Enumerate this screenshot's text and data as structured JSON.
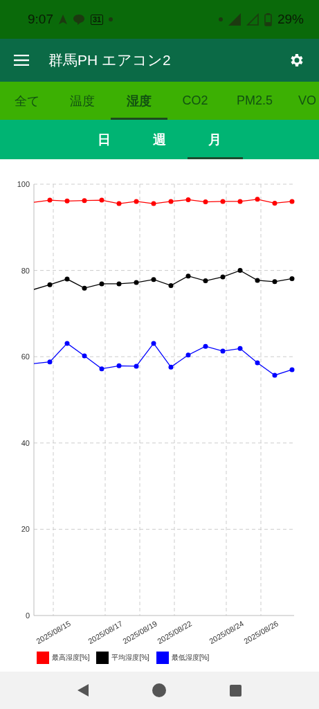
{
  "status_bar": {
    "time": "9:07",
    "calendar_date": "31",
    "battery": "29%"
  },
  "toolbar": {
    "title": "群馬PH エアコン2"
  },
  "tabs": [
    {
      "label": "全て",
      "selected": false
    },
    {
      "label": "温度",
      "selected": false
    },
    {
      "label": "湿度",
      "selected": true
    },
    {
      "label": "CO2",
      "selected": false
    },
    {
      "label": "PM2.5",
      "selected": false
    },
    {
      "label": "VO",
      "selected": false
    }
  ],
  "period_tabs": [
    {
      "label": "日",
      "selected": false
    },
    {
      "label": "週",
      "selected": false
    },
    {
      "label": "月",
      "selected": true
    }
  ],
  "chart": {
    "chart_data": {
      "type": "line",
      "categories": [
        null,
        "2025/08/15",
        null,
        null,
        "2025/08/17",
        null,
        "2025/08/19",
        null,
        "2025/08/22",
        null,
        null,
        "2025/08/24",
        null,
        "2025/08/26",
        null,
        null
      ],
      "ylim": [
        0,
        100
      ],
      "yticks": [
        0,
        20,
        40,
        60,
        80,
        100
      ],
      "grid": true,
      "series": [
        {
          "name": "最高湿度[%]",
          "color": "#ff0000",
          "marker": "circle",
          "values": [
            95.8,
            96.3,
            96.1,
            96.2,
            96.3,
            95.5,
            96.0,
            95.5,
            96.0,
            96.4,
            95.9,
            96.0,
            96.0,
            96.5,
            95.6,
            96.0
          ]
        },
        {
          "name": "平均湿度[%]",
          "color": "#000000",
          "marker": "circle",
          "values": [
            75.6,
            76.7,
            78.0,
            75.9,
            76.9,
            76.9,
            77.2,
            77.9,
            76.5,
            78.7,
            77.6,
            78.5,
            80.0,
            77.7,
            77.4,
            78.1
          ]
        },
        {
          "name": "最低湿度[%]",
          "color": "#0000ff",
          "marker": "circle",
          "values": [
            58.4,
            58.8,
            63.1,
            60.2,
            57.2,
            57.9,
            57.8,
            63.1,
            57.6,
            60.4,
            62.4,
            61.3,
            61.9,
            58.6,
            55.7,
            57.0
          ]
        }
      ]
    }
  }
}
